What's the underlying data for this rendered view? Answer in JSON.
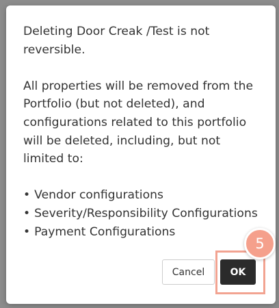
{
  "dialog": {
    "message": {
      "line1": "Deleting Door Creak /Test is not reversible.",
      "line2": "All properties will be removed from the Portfolio (but not deleted), and configurations related to this portfolio will be deleted, including, but not limited to:",
      "bullets": [
        "Vendor configurations",
        "Severity/Responsibility Configurations",
        "Payment Configurations"
      ]
    },
    "cancel_label": "Cancel",
    "ok_label": "OK"
  },
  "annotation": {
    "step_number": "5",
    "badge_color": "#f5a08c",
    "highlight_color": "#f2a391"
  }
}
